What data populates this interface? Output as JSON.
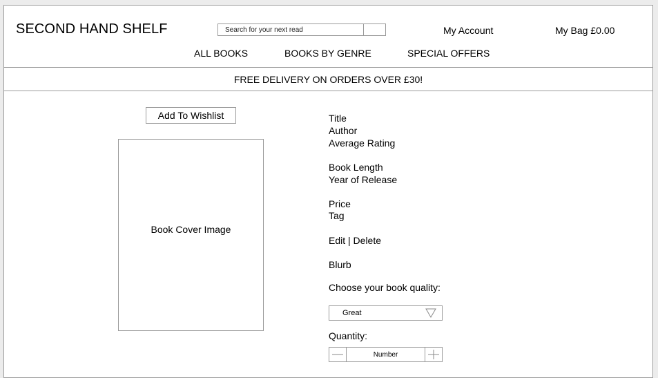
{
  "header": {
    "site_title": "SECOND HAND SHELF",
    "search_placeholder": "Search for your next read",
    "account_label": "My Account",
    "bag_label": "My Bag £0.00"
  },
  "nav": {
    "items": [
      {
        "label": "ALL BOOKS"
      },
      {
        "label": "BOOKS BY GENRE"
      },
      {
        "label": "SPECIAL OFFERS"
      }
    ]
  },
  "banner": {
    "text": "FREE DELIVERY ON ORDERS OVER £30!"
  },
  "product": {
    "wishlist_label": "Add To Wishlist",
    "cover_label": "Book Cover Image",
    "title": "Title",
    "author": "Author",
    "rating": "Average Rating",
    "length": "Book Length",
    "year": "Year of Release",
    "price": "Price",
    "tag": "Tag",
    "edit_label": "Edit",
    "separator": "|",
    "delete_label": "Delete",
    "blurb": "Blurb",
    "quality_label": "Choose your book quality:",
    "quality_value": "Great",
    "quantity_label": "Quantity:",
    "quantity_value": "Number"
  },
  "icons": {
    "dropdown": "triangle-down-icon",
    "decrement": "minus-icon",
    "increment": "plus-icon"
  },
  "colors": {
    "border": "#9a9a9a",
    "outer_background": "#ececec",
    "page_background": "#ffffff"
  }
}
